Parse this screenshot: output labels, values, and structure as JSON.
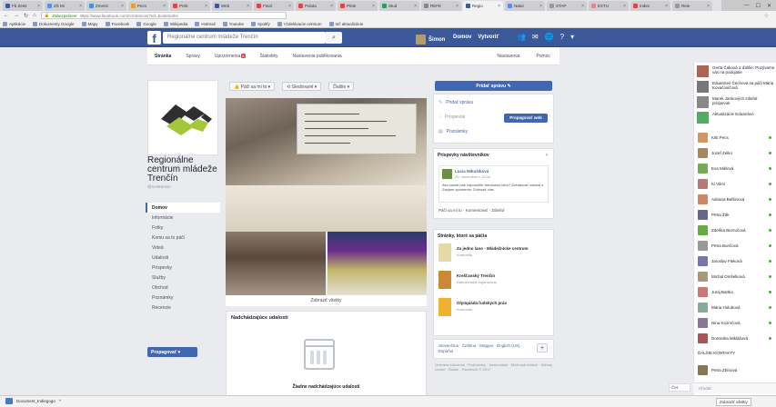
{
  "browser": {
    "tabs": [
      {
        "label": "Fb Zenit",
        "color": "#3b5998"
      },
      {
        "label": "ZŠ Mi",
        "color": "#5b8def"
      },
      {
        "label": "Zmenit",
        "color": "#4a90d9"
      },
      {
        "label": "Pecs",
        "color": "#e8a020"
      },
      {
        "label": "Preb",
        "color": "#d44"
      },
      {
        "label": "Web",
        "color": "#3b5998"
      },
      {
        "label": "Final",
        "color": "#d44"
      },
      {
        "label": "Poluta",
        "color": "#d44"
      },
      {
        "label": "Pinte",
        "color": "#d44"
      },
      {
        "label": "Stud",
        "color": "#2a9d5c"
      },
      {
        "label": "REFE",
        "color": "#888"
      },
      {
        "label": "Regio",
        "color": "#3b5998",
        "active": true
      },
      {
        "label": "Natur",
        "color": "#5b8def"
      },
      {
        "label": "STAP",
        "color": "#999"
      },
      {
        "label": "EXTU",
        "color": "#d88"
      },
      {
        "label": "Index",
        "color": "#d44"
      },
      {
        "label": "Reie",
        "color": "#999"
      }
    ],
    "url_secure_label": "Zabezpečené",
    "url": "https://www.facebook.com/rcmtrencin/?ref=bookmarks",
    "bookmarks": [
      "Aplikácie",
      "Dokumenty Google",
      "Mapy",
      "Facebook",
      "Google",
      "Wikipedia",
      "Hotmail",
      "Youtube",
      "Spotify",
      "Vzdelávacie centrum",
      "Inč aktualizácie"
    ]
  },
  "fb": {
    "logo": "f",
    "search_placeholder": "Regionálne centrum mládeže Trenčín",
    "user_name": "Šimon",
    "nav_home": "Domov",
    "nav_create": "Vytvoriť"
  },
  "page": {
    "tabs": [
      "Stránka",
      "Správy",
      "Upozornenia",
      "Štatistiky",
      "Nastavenia publikovania"
    ],
    "notif_badge": "5",
    "tabs_right": [
      "Nastavenia",
      "Pomoc"
    ],
    "name": "Regionálne centrum mládeže Trenčín",
    "handle": "@rcmtrencin",
    "nav": [
      "Domov",
      "Informácie",
      "Fotky",
      "Komu sa to páči",
      "Videá",
      "Udalosti",
      "Príspevky",
      "Služby",
      "Obchod",
      "Poznámky",
      "Recenzie"
    ],
    "promote_btn": "Propagovať",
    "action_buttons": [
      "Páči sa mi to",
      "Sledované",
      "Ďalšie"
    ],
    "see_all_photos": "Zobraziť všetky",
    "upcoming_title": "Nadchádzajúce udalosti",
    "no_events": "Žiadne nadchádzajúce udalosti",
    "share_btn": "Pridať správu",
    "share_rows": [
      "Pridať správu",
      "Príspevok",
      "Poznámky"
    ],
    "promote_web": "Propagovať web",
    "featured_title": "Príspevky návštevníkov",
    "featured_name": "Lucia Mikušiková",
    "featured_date": "20. novembra o 12:04",
    "featured_body": "Ako zadať nás odporúčite trenčanov lebo? Zvedavosť ostáva z. Zaujme spomenie, Zobraziť viac",
    "featured_actions": "Páči sa mi to · Komentovať · Zdieľať",
    "liked_title": "Stránky, ktoré sa páčia",
    "liked": [
      {
        "name": "Za jedno lano - Mládežnícke centrum",
        "cat": "Komunita",
        "color": "#e6d9a8"
      },
      {
        "name": "Krešťanský Trenčín",
        "cat": "Náboženská organizácia",
        "color": "#c83"
      },
      {
        "name": "Olympiáda ľudských práv",
        "cat": "Komunita",
        "color": "#f0b030"
      }
    ],
    "languages": "Slovenčina · Čeština · Magyar · English (US) · Español",
    "footer": "Ochrana súkromia · Podmienky · Inzerovanie · Možnosti reklám · Súbory cookie · Ďalšie · Facebook © 2017"
  },
  "chat": {
    "top": [
      {
        "name": "Gerta Čaková a ďalšie: Pozývame vás na podujatie",
        "color": "#a65"
      },
      {
        "name": "Eduardovi Čechová sa páči Mária Kovačovičová",
        "color": "#777"
      },
      {
        "name": "Marek Jankových zdieľal príspevok",
        "color": "#888"
      },
      {
        "name": "Aktualizácie Eduardovi",
        "color": "#5a6"
      }
    ],
    "contacts": [
      {
        "name": "Kitti Pecs",
        "color": "#c96"
      },
      {
        "name": "Jozef Zelko",
        "color": "#a85"
      },
      {
        "name": "Eva Miklová",
        "color": "#7a5"
      },
      {
        "name": "Ki Vilmi",
        "color": "#b77"
      },
      {
        "name": "Adriana Belšinová",
        "color": "#c86"
      },
      {
        "name": "Petra Žák",
        "color": "#668"
      },
      {
        "name": "Zdeňka Bezručová",
        "color": "#6a4"
      },
      {
        "name": "Petra Buričová",
        "color": "#999"
      },
      {
        "name": "Jaroslav Fleková",
        "color": "#77a"
      },
      {
        "name": "Michal Omšelková",
        "color": "#a97"
      },
      {
        "name": "Juraj Bartko",
        "color": "#c77"
      },
      {
        "name": "Mária Holubová",
        "color": "#8a9"
      },
      {
        "name": "Nina Kozmčová",
        "color": "#879"
      },
      {
        "name": "Dominika Miklášová",
        "color": "#a55"
      }
    ],
    "more_label": "ĎALŠIE KONTAKTY",
    "more_contact": "Petra Zbínová",
    "search": "Hľadať",
    "chat_button": "Čet"
  },
  "downloads": {
    "file": "Document_Indiegogo",
    "show_all": "Zobraziť všetky"
  }
}
